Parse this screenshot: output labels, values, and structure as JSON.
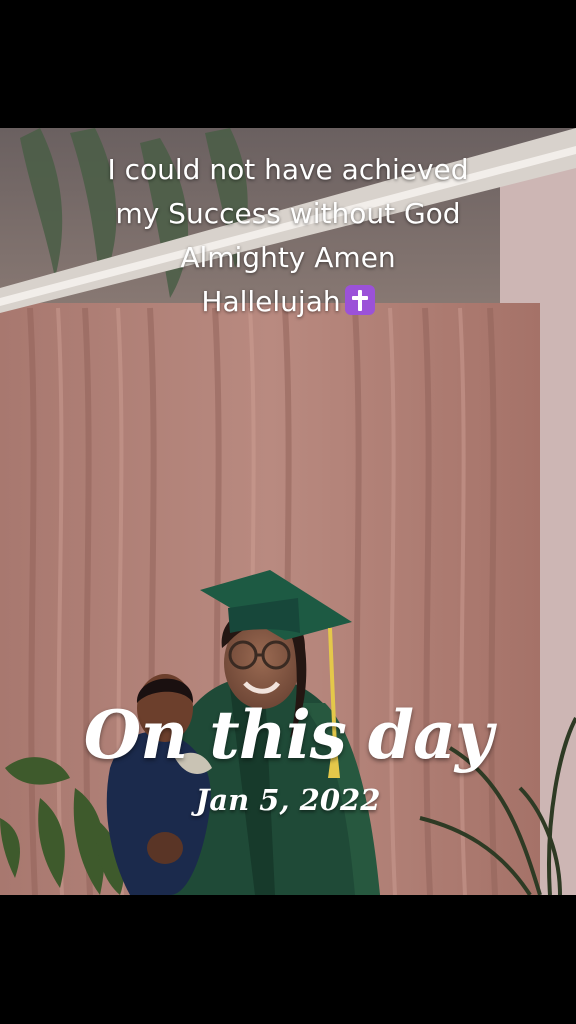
{
  "overlay": {
    "caption": "I could not have achieved\nmy Success without God\nAlmighty Amen\nHallelujah",
    "caption_emoji": "latin-cross-emoji",
    "memory_title": "On this day",
    "memory_date": "Jan 5, 2022"
  },
  "photo": {
    "subject": "graduation-photo",
    "colors": {
      "curtain": "#b7857c",
      "gown": "#1f4a37",
      "cap": "#1d5a43",
      "tassel": "#e4c84a",
      "plant": "#3e5a2c",
      "letterbox": "#000000"
    }
  }
}
